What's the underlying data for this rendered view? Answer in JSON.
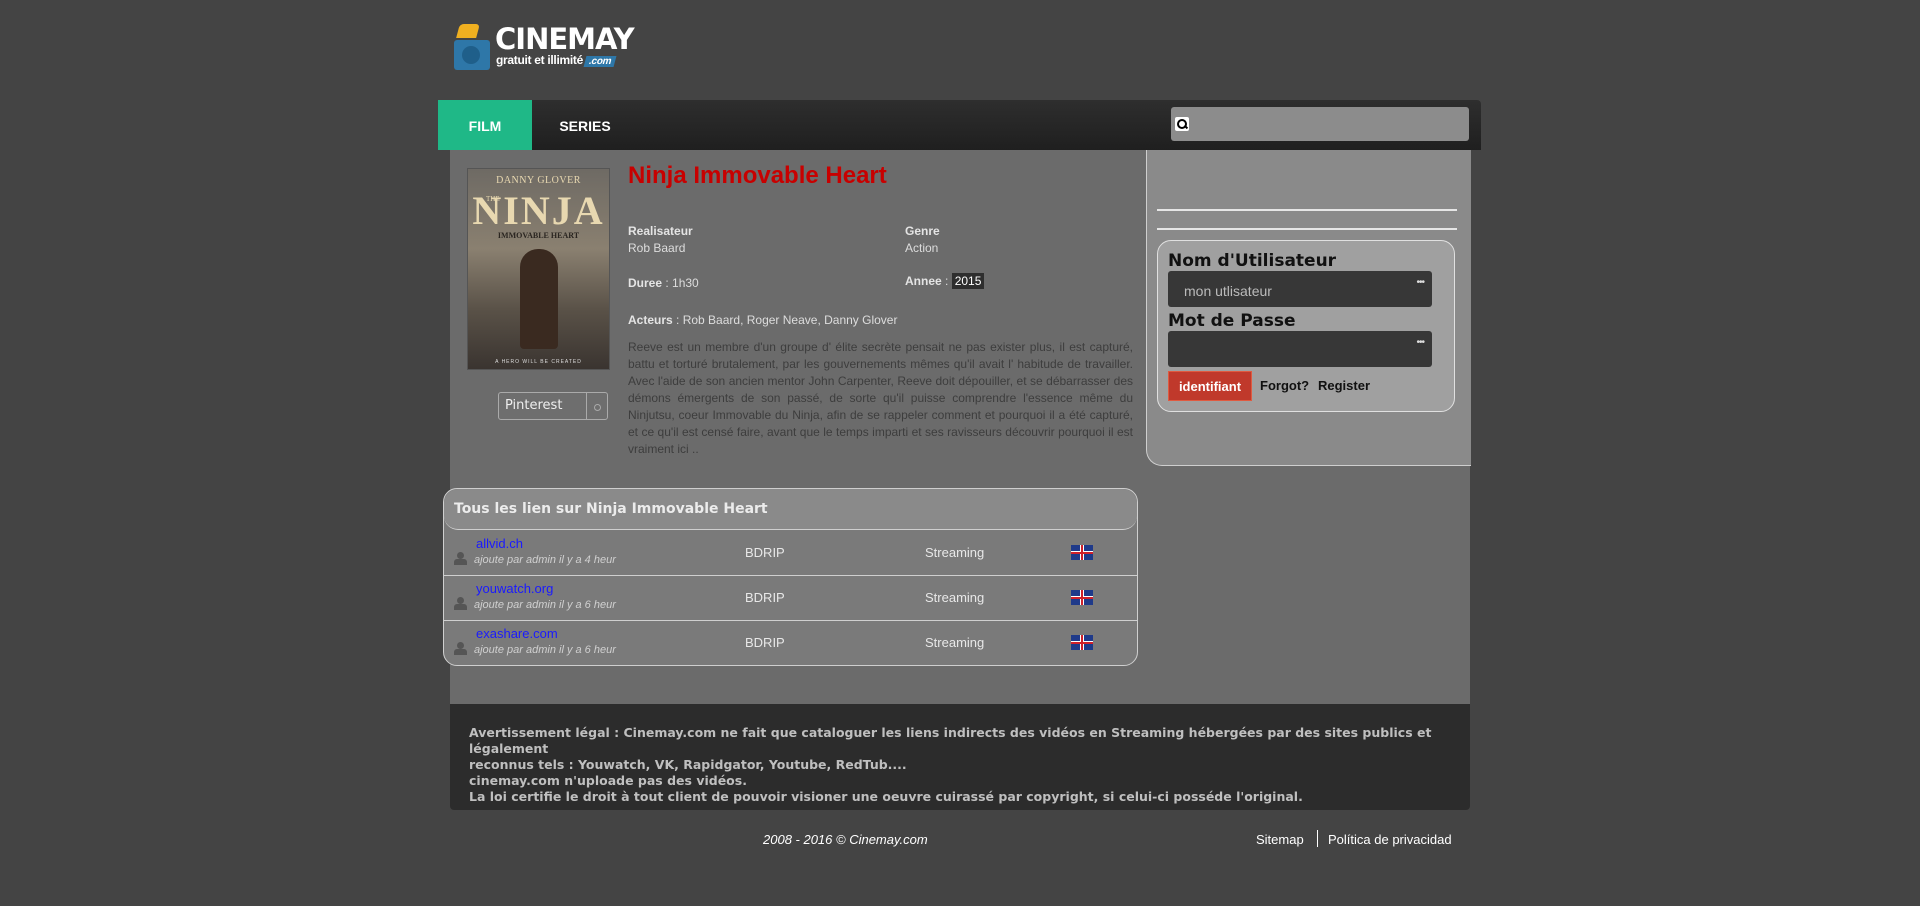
{
  "logo": {
    "title": "CINEMAY",
    "subtitle": "gratuit et illimité",
    "domain": ".com"
  },
  "nav": {
    "tabs": [
      {
        "label": "FILM"
      },
      {
        "label": "SERIES"
      }
    ],
    "search": {
      "placeholder": "",
      "icon": "search-icon"
    }
  },
  "movie": {
    "title": "Ninja Immovable Heart",
    "poster": {
      "actor": "DANNY GLOVER",
      "the": "THE",
      "word": "NINJA",
      "subtitle": "IMMOVABLE HEART",
      "tagline": "A HERO WILL BE CREATED"
    },
    "director_label": "Realisateur",
    "director": "Rob Baard",
    "genre_label": "Genre",
    "genre": "Action",
    "duration_label": "Duree",
    "duration": "1h30",
    "year_label": "Annee",
    "year": "2015",
    "actors_label": "Acteurs",
    "actors": "Rob Baard, Roger Neave, Danny Glover",
    "synopsis": "Reeve est un membre d'un groupe d' élite secrète pensait ne pas exister plus, il est capturé, battu et torturé brutalement, par les gouvernements mêmes qu'il avait l' habitude de travailler. Avec l'aide de son ancien mentor John Carpenter, Reeve doit dépouiller, et se débarrasser des démons émergents de son passé, de sorte qu'il puisse comprendre l'essence même du Ninjutsu, coeur Immovable du Ninja, afin de se rappeler comment et pourquoi il a été capturé, et ce qu'il est censé faire, avant que le temps imparti et ses ravisseurs découvrir pourquoi il est vraiment ici .."
  },
  "share": {
    "selected": "Pinterest"
  },
  "links": {
    "title": "Tous les lien sur Ninja Immovable Heart",
    "rows": [
      {
        "host": "allvid.ch",
        "added": "ajoute par admin il y a 4 heur",
        "quality": "BDRIP",
        "type": "Streaming",
        "flag": "uk-flag-icon"
      },
      {
        "host": "youwatch.org",
        "added": "ajoute par admin il y a 6 heur",
        "quality": "BDRIP",
        "type": "Streaming",
        "flag": "uk-flag-icon"
      },
      {
        "host": "exashare.com",
        "added": "ajoute par admin il y a 6 heur",
        "quality": "BDRIP",
        "type": "Streaming",
        "flag": "uk-flag-icon"
      }
    ]
  },
  "login": {
    "username_label": "Nom d'Utilisateur",
    "username_value": "mon utlisateur",
    "password_label": "Mot de Passe",
    "password_value": "",
    "submit": "identifiant",
    "forgot": "Forgot?",
    "register": "Register"
  },
  "footer": {
    "legal": "Avertissement légal : Cinemay.com ne fait que cataloguer les liens indirects des vidéos en Streaming hébergées par des sites publics et légalement reconnus tels : Youwatch, VK, Rapidgator, Youtube, RedTub.... cinemay.com n'uploade pas des vidéos. La loi certifie le droit à tout client de pouvoir visioner une oeuvre cuirassé par copyright, si celui-ci posséde l'original.",
    "legal_lines": [
      "Avertissement légal : Cinemay.com ne fait que cataloguer les liens indirects des vidéos en Streaming hébergées par des sites publics et légalement",
      "reconnus tels : Youwatch, VK, Rapidgator, Youtube, RedTub....",
      "cinemay.com n'uploade pas des vidéos.",
      "La loi certifie le droit à tout client de pouvoir visioner une oeuvre cuirassé par copyright, si celui-ci posséde l'original."
    ],
    "copyright": "2008 - 2016 © Cinemay.com",
    "sitemap": "Sitemap",
    "privacy": "Política de privacidad"
  },
  "colors": {
    "background": "#444444",
    "accent_tab": "#1fb887",
    "title_red": "#c80000",
    "link_blue": "#1a1aff",
    "button_red": "#c0392b"
  }
}
